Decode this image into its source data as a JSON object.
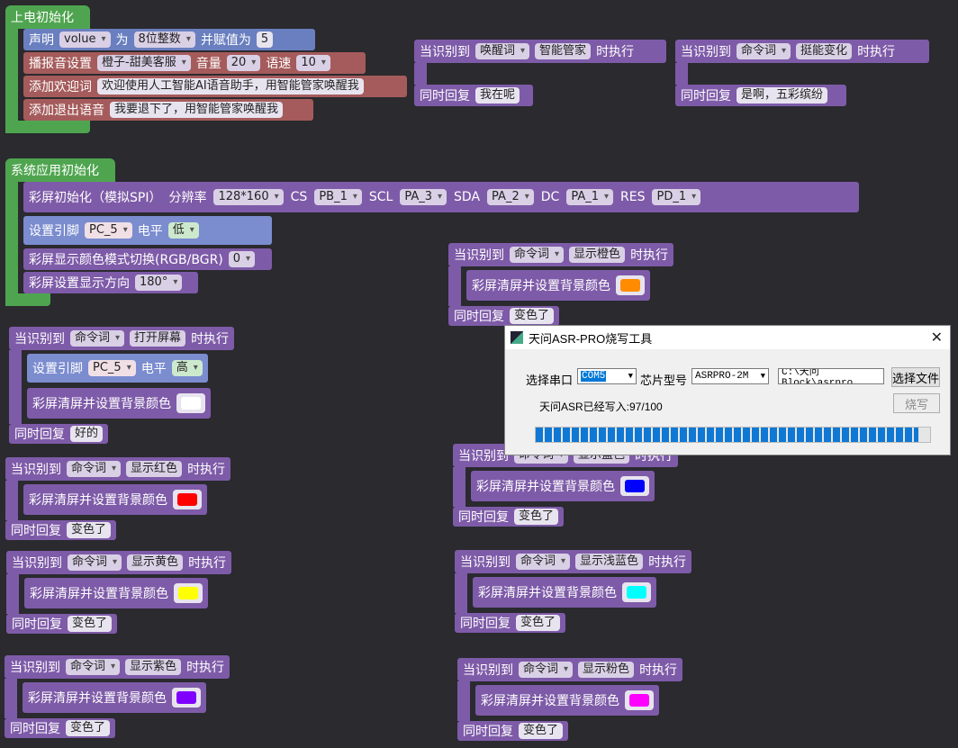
{
  "power_init": {
    "header": "上电初始化",
    "declare": {
      "label1": "声明",
      "var": "volue",
      "label2": "为",
      "type": "8位整数",
      "label3": "并赋值为",
      "value": "5"
    },
    "voice": {
      "label1": "播报音设置",
      "voice": "橙子-甜美客服",
      "label2": "音量",
      "volume": "20",
      "label3": "语速",
      "speed": "10"
    },
    "welcome": {
      "label": "添加欢迎词",
      "text": "欢迎使用人工智能AI语音助手，用智能管家唤醒我"
    },
    "exit": {
      "label": "添加退出语音",
      "text": "我要退下了，用智能管家唤醒我"
    }
  },
  "wake_block": {
    "when": "当识别到",
    "kind": "唤醒词",
    "word": "智能管家",
    "exec": "时执行",
    "reply_label": "同时回复",
    "reply": "我在呢"
  },
  "cmd_change": {
    "when": "当识别到",
    "kind": "命令词",
    "word": "挺能变化",
    "exec": "时执行",
    "reply_label": "同时回复",
    "reply": "是啊，五彩缤纷"
  },
  "sys_init": {
    "header": "系统应用初始化",
    "screen": {
      "label": "彩屏初始化（模拟SPI）",
      "res_label": "分辨率",
      "res": "128*160",
      "cs_label": "CS",
      "cs": "PB_1",
      "scl_label": "SCL",
      "scl": "PA_3",
      "sda_label": "SDA",
      "sda": "PA_2",
      "dc_label": "DC",
      "dc": "PA_1",
      "res2_label": "RES",
      "res2": "PD_1"
    },
    "pin": {
      "label": "设置引脚",
      "pin": "PC_5",
      "level_label": "电平",
      "level": "低"
    },
    "color_mode": {
      "label": "彩屏显示颜色模式切换(RGB/BGR)",
      "value": "0"
    },
    "direction": {
      "label": "彩屏设置显示方向",
      "value": "180°"
    }
  },
  "cmd_blocks": [
    {
      "id": "orange",
      "when": "当识别到",
      "kind": "命令词",
      "word": "显示橙色",
      "exec": "时执行",
      "action": "彩屏清屏并设置背景颜色",
      "color": "#ff8c00",
      "reply_label": "同时回复",
      "reply": "变色了"
    },
    {
      "id": "open",
      "when": "当识别到",
      "kind": "命令词",
      "word": "打开屏幕",
      "exec": "时执行",
      "pin_label": "设置引脚",
      "pin": "PC_5",
      "level_label": "电平",
      "level": "高",
      "action": "彩屏清屏并设置背景颜色",
      "color": "#ffffff",
      "reply_label": "同时回复",
      "reply": "好的"
    },
    {
      "id": "red",
      "when": "当识别到",
      "kind": "命令词",
      "word": "显示红色",
      "exec": "时执行",
      "action": "彩屏清屏并设置背景颜色",
      "color": "#ff0000",
      "reply_label": "同时回复",
      "reply": "变色了"
    },
    {
      "id": "blue",
      "when": "当识别到",
      "kind": "命令词",
      "word": "显示蓝色",
      "exec": "时执行",
      "action": "彩屏清屏并设置背景颜色",
      "color": "#0000ff",
      "reply_label": "同时回复",
      "reply": "变色了"
    },
    {
      "id": "yellow",
      "when": "当识别到",
      "kind": "命令词",
      "word": "显示黄色",
      "exec": "时执行",
      "action": "彩屏清屏并设置背景颜色",
      "color": "#ffff00",
      "reply_label": "同时回复",
      "reply": "变色了"
    },
    {
      "id": "cyan",
      "when": "当识别到",
      "kind": "命令词",
      "word": "显示浅蓝色",
      "exec": "时执行",
      "action": "彩屏清屏并设置背景颜色",
      "color": "#00ffff",
      "reply_label": "同时回复",
      "reply": "变色了"
    },
    {
      "id": "purple",
      "when": "当识别到",
      "kind": "命令词",
      "word": "显示紫色",
      "exec": "时执行",
      "action": "彩屏清屏并设置背景颜色",
      "color": "#8000ff",
      "reply_label": "同时回复",
      "reply": "变色了"
    },
    {
      "id": "pink",
      "when": "当识别到",
      "kind": "命令词",
      "word": "显示粉色",
      "exec": "时执行",
      "action": "彩屏清屏并设置背景颜色",
      "color": "#ff00ff",
      "reply_label": "同时回复",
      "reply": "变色了"
    }
  ],
  "dialog": {
    "title": "天问ASR-PRO烧写工具",
    "port_label": "选择串口",
    "port": "COM5",
    "chip_label": "芯片型号",
    "chip": "ASRPRO-2M",
    "path": "C:\\天问Block\\asrpro",
    "choose_file": "选择文件",
    "burn": "烧写",
    "status": "天问ASR已经写入:97/100",
    "progress": 0.97,
    "close": "✕"
  }
}
